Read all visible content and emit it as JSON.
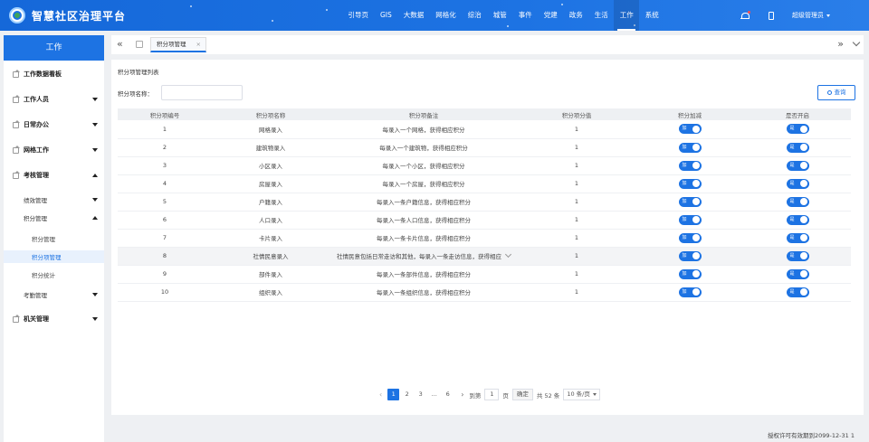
{
  "header": {
    "title": "智慧社区治理平台",
    "nav": [
      "引导页",
      "GIS",
      "大数据",
      "网格化",
      "综治",
      "城管",
      "事件",
      "党建",
      "政务",
      "生活",
      "工作",
      "系统"
    ],
    "active_nav": 10,
    "user": "超级管理员"
  },
  "sidebar": {
    "title": "工作",
    "items": [
      {
        "label": "工作数据看板"
      },
      {
        "label": "工作人员"
      },
      {
        "label": "日常办公"
      },
      {
        "label": "网格工作"
      },
      {
        "label": "考核管理"
      }
    ],
    "sub": {
      "perf": "绩效管理",
      "points": "积分管理",
      "attend": "考勤管理"
    },
    "leaf": {
      "points_mgmt": "积分管理",
      "points_item_mgmt": "积分项管理",
      "points_stats": "积分统计"
    },
    "last": "机关管理"
  },
  "tabs": {
    "current": "积分项管理"
  },
  "page": {
    "section_title": "积分项管理列表",
    "filter_label": "积分项名称：",
    "query_label": "查询"
  },
  "table": {
    "headers": [
      "积分项编号",
      "积分项名称",
      "积分项备注",
      "积分项分值",
      "积分加减",
      "是否开启"
    ],
    "rows": [
      {
        "id": "1",
        "name": "网格录入",
        "remark": "每录入一个网格，获得相应积分",
        "score": "1",
        "sign": "加",
        "on": "是"
      },
      {
        "id": "2",
        "name": "建筑物录入",
        "remark": "每录入一个建筑物，获得相应积分",
        "score": "1",
        "sign": "加",
        "on": "是"
      },
      {
        "id": "3",
        "name": "小区录入",
        "remark": "每录入一个小区，获得相应积分",
        "score": "1",
        "sign": "加",
        "on": "是"
      },
      {
        "id": "4",
        "name": "房屋录入",
        "remark": "每录入一个房屋，获得相应积分",
        "score": "1",
        "sign": "加",
        "on": "是"
      },
      {
        "id": "5",
        "name": "户籍录入",
        "remark": "每录入一条户籍信息，获得相应积分",
        "score": "1",
        "sign": "加",
        "on": "是"
      },
      {
        "id": "6",
        "name": "人口录入",
        "remark": "每录入一条人口信息，获得相应积分",
        "score": "1",
        "sign": "加",
        "on": "是"
      },
      {
        "id": "7",
        "name": "卡片录入",
        "remark": "每录入一条卡片信息，获得相应积分",
        "score": "1",
        "sign": "加",
        "on": "是"
      },
      {
        "id": "8",
        "name": "社情民意录入",
        "remark": "社情民意包括日常走访和其他，每录入一条走访信息，获得相应",
        "score": "1",
        "sign": "加",
        "on": "是"
      },
      {
        "id": "9",
        "name": "部件录入",
        "remark": "每录入一条部件信息，获得相应积分",
        "score": "1",
        "sign": "加",
        "on": "是"
      },
      {
        "id": "10",
        "name": "组织录入",
        "remark": "每录入一条组织信息，获得相应积分",
        "score": "1",
        "sign": "加",
        "on": "是"
      }
    ]
  },
  "pager": {
    "pages": [
      "1",
      "2",
      "3",
      "...",
      "6"
    ],
    "goto_label": "到第",
    "goto_value": "1",
    "page_unit": "页",
    "confirm": "确定",
    "total": "共 52 条",
    "page_size": "10 条/页"
  },
  "footer": {
    "license": "授权许可有效期到2099-12-31 1"
  }
}
